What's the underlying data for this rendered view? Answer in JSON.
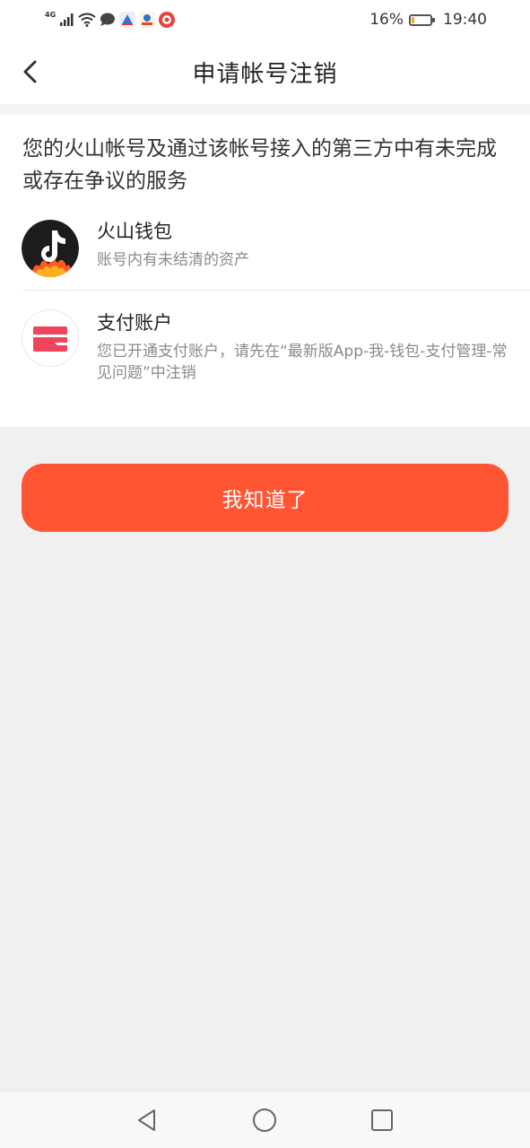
{
  "status_bar": {
    "network": "4G",
    "battery_percent": "16%",
    "battery_level": 0.16,
    "time": "19:40"
  },
  "header": {
    "title": "申请帐号注销"
  },
  "notice": "您的火山帐号及通过该帐号接入的第三方中有未完成或存在争议的服务",
  "services": [
    {
      "name": "火山钱包",
      "desc": "账号内有未结清的资产",
      "icon": "huoshan-app-icon"
    },
    {
      "name": "支付账户",
      "desc": "您已开通支付账户，请先在“最新版App-我-钱包-支付管理-常见问题”中注销",
      "icon": "wallet-card-icon"
    }
  ],
  "confirm_button": {
    "label": "我知道了"
  },
  "colors": {
    "accent": "#ff5533",
    "app_icon_bg": "#1c1c1c",
    "wallet_icon": "#f0445c"
  }
}
